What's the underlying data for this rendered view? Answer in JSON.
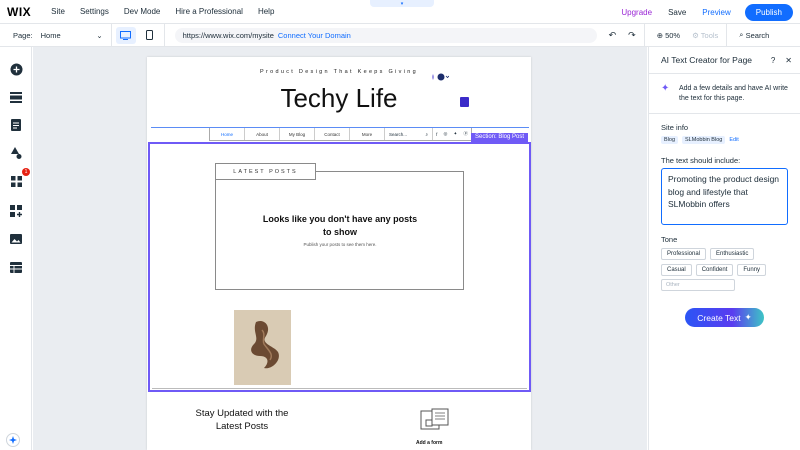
{
  "topbar": {
    "logo": "WIX",
    "menu": [
      "Site",
      "Settings",
      "Dev Mode",
      "Hire a Professional",
      "Help"
    ],
    "upgrade": "Upgrade",
    "save": "Save",
    "preview": "Preview",
    "publish": "Publish"
  },
  "toolbar": {
    "page_label": "Page:",
    "page_value": "Home",
    "url": "https://www.wix.com/mysite",
    "connect": "Connect Your Domain",
    "zoom": "50%",
    "tools": "Tools",
    "search": "Search"
  },
  "leftbar": {
    "badge": "1",
    "icons": [
      "add-icon",
      "sections-icon",
      "pages-icon",
      "design-icon",
      "apps-icon",
      "business-icon",
      "media-icon",
      "cms-icon"
    ]
  },
  "site": {
    "tagline": "Product Design That Keeps Giving",
    "title": "Techy Life",
    "nav": [
      "Home",
      "About",
      "My Blog",
      "Contact",
      "More"
    ],
    "nav_search": "Search...",
    "section_tag": "Section: Blog Post",
    "latest_posts": "LATEST POSTS",
    "no_posts": "Looks like you don't have any posts to show",
    "no_posts_sub": "Publish your posts to see them here.",
    "stay_updated": "Stay Updated with the Latest Posts",
    "add_form": "Add a form"
  },
  "panel": {
    "title": "AI Text Creator for Page",
    "intro": "Add a few details and have AI write the text for this page.",
    "site_info_label": "Site info",
    "chips": [
      "Blog",
      "SLMobbin Blog"
    ],
    "edit": "Edit",
    "include_label": "The text should include:",
    "include_value": "Promoting the product design blog and lifestyle that SLMobbin offers",
    "tone_label": "Tone",
    "tones": [
      "Professional",
      "Enthusiastic",
      "Casual",
      "Confident",
      "Funny"
    ],
    "other_placeholder": "Other",
    "create_button": "Create Text"
  },
  "colors": {
    "accent": "#116dff",
    "section": "#6f5af6",
    "upgrade": "#9a27d5"
  }
}
